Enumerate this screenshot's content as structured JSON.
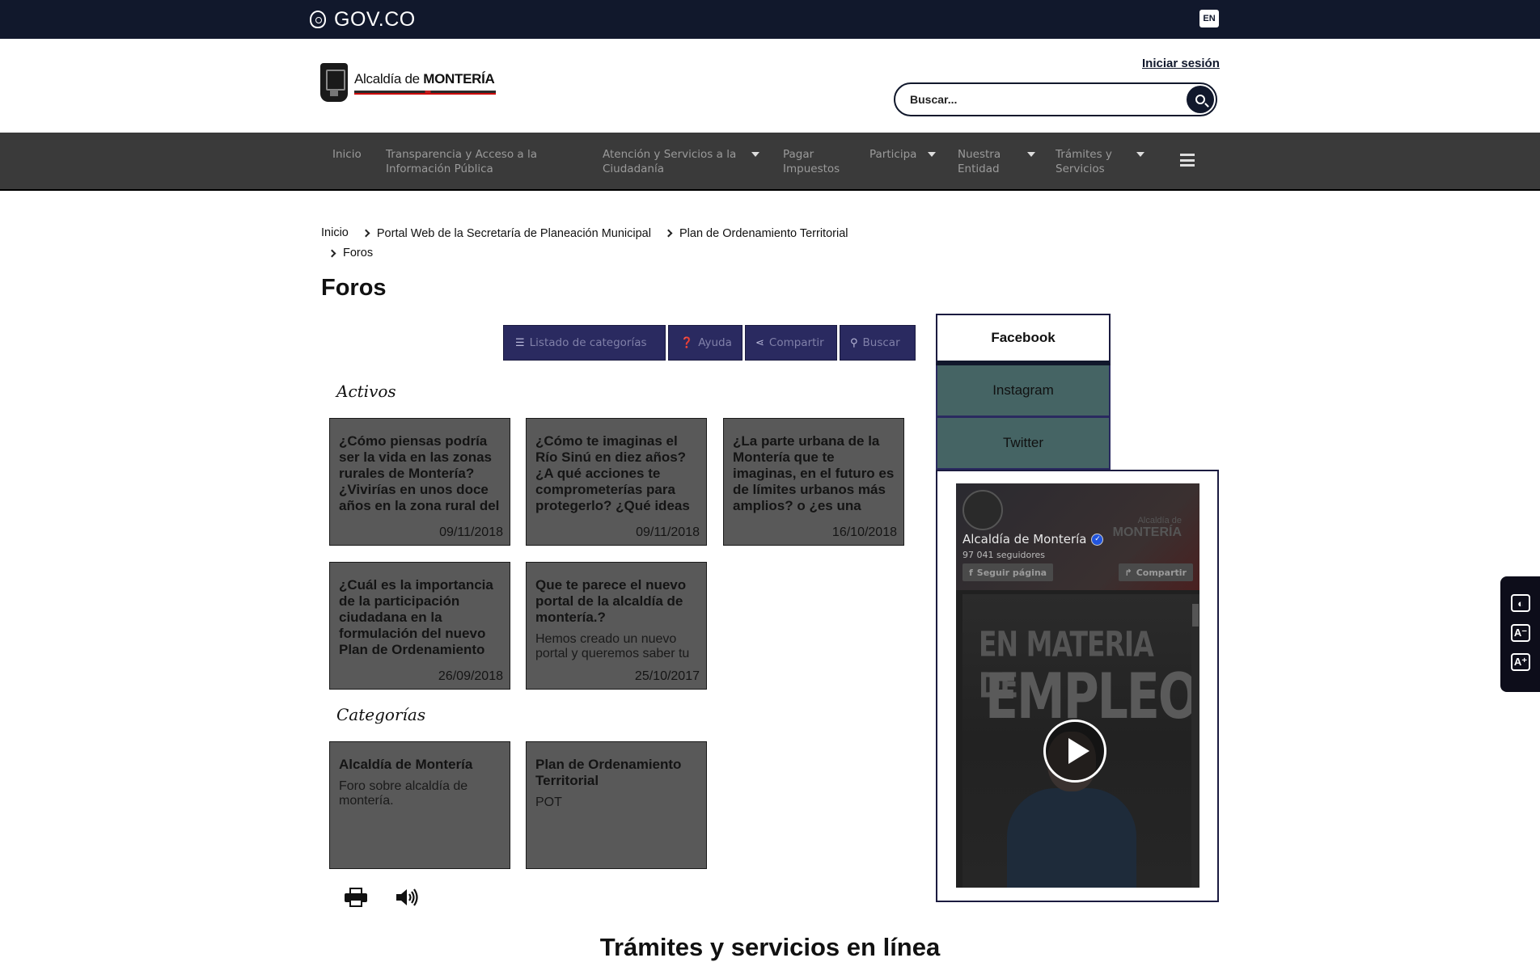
{
  "govbar": {
    "brand": "GOV.CO",
    "lang": "EN"
  },
  "header": {
    "logo_prefix": "Alcaldía de ",
    "logo_name": "MONTERÍA",
    "login": "Iniciar sesión",
    "search_placeholder": "Buscar..."
  },
  "nav": [
    {
      "label": "Inicio",
      "dropdown": false
    },
    {
      "label": "Transparencia y Acceso a la Información Pública",
      "dropdown": false
    },
    {
      "label": "Atención y Servicios a la Ciudadanía",
      "dropdown": true
    },
    {
      "label": "Pagar Impuestos",
      "dropdown": false
    },
    {
      "label": "Participa",
      "dropdown": true
    },
    {
      "label": "Nuestra Entidad",
      "dropdown": true
    },
    {
      "label": "Trámites y Servicios",
      "dropdown": true
    }
  ],
  "breadcrumb": [
    "Inicio",
    "Portal Web de la Secretaría de Planeación Municipal",
    "Plan de Ordenamiento Territorial",
    "Foros"
  ],
  "page_title": "Foros",
  "toolbar": {
    "categories": "Listado de categorías",
    "help": "Ayuda",
    "share": "Compartir",
    "search": "Buscar"
  },
  "sections": {
    "active": "Activos",
    "categories": "Categorías"
  },
  "active_forums": [
    {
      "title": "¿Cómo piensas podría ser la vida en las zonas rurales de Montería? ¿Vivirías en unos doce años en la zona rural del municipio?",
      "date": "09/11/2018"
    },
    {
      "title": "¿Cómo te imaginas el Río Sinú en diez años? ¿A qué acciones te comprometerías para protegerlo? ¿Qué ideas propones para lograrlo?",
      "date": "09/11/2018"
    },
    {
      "title": "¿La parte urbana de la Montería que te imaginas, en el futuro es de límites urbanos más amplios? o ¿es una ciudad densa?",
      "date": "16/10/2018"
    },
    {
      "title": "¿Cuál es la importancia de la participación ciudadana en la formulación del nuevo Plan de Ordenamiento Territorial?",
      "date": "26/09/2018"
    },
    {
      "title": "Que te parece el nuevo portal de la alcaldía de montería.?",
      "desc": "Hemos creado un nuevo portal y queremos saber tu opinión",
      "date": "25/10/2017"
    }
  ],
  "categories": [
    {
      "title": "Alcaldía de Montería",
      "desc": "Foro sobre alcaldía de montería."
    },
    {
      "title": "Plan de Ordenamiento Territorial",
      "desc": "POT"
    }
  ],
  "social": {
    "tabs": [
      "Facebook",
      "Instagram",
      "Twitter"
    ],
    "fb": {
      "page_name": "Alcaldía de Montería",
      "followers": "97 041 seguidores",
      "follow": "Seguir página",
      "share": "Compartir",
      "cover_small": "Alcaldía de",
      "cover_big": "MONTERÍA",
      "video_line1": "EN MATERIA DE",
      "video_line2": "EMPLEO"
    }
  },
  "footer_title": "Trámites y servicios en línea"
}
